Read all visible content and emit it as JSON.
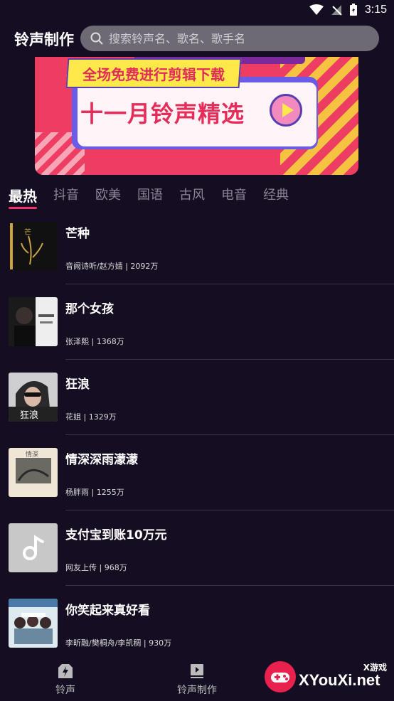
{
  "status": {
    "time": "3:15"
  },
  "header": {
    "title": "铃声制作",
    "search_placeholder": "搜索铃声名、歌名、歌手名"
  },
  "banner": {
    "tag_text": "全场免费进行剪辑下载",
    "headline": "十一月铃声精选"
  },
  "tabs": [
    {
      "label": "最热",
      "active": true
    },
    {
      "label": "抖音",
      "active": false
    },
    {
      "label": "欧美",
      "active": false
    },
    {
      "label": "国语",
      "active": false
    },
    {
      "label": "古风",
      "active": false
    },
    {
      "label": "电音",
      "active": false
    },
    {
      "label": "经典",
      "active": false
    }
  ],
  "songs": [
    {
      "title": "芒种",
      "meta": "音阙诗听/赵方婧 | 2092万"
    },
    {
      "title": "那个女孩",
      "meta": "张泽熙 | 1368万"
    },
    {
      "title": "狂浪",
      "meta": "花姐 | 1329万"
    },
    {
      "title": "情深深雨濛濛",
      "meta": "杨胖雨 | 1255万"
    },
    {
      "title": "支付宝到账10万元",
      "meta": "网友上传 | 968万"
    },
    {
      "title": "你笑起来真好看",
      "meta": "李昕融/樊桐舟/李凯稠 | 930万"
    }
  ],
  "bottom_nav": [
    {
      "label": "铃声",
      "icon": "lightning-icon"
    },
    {
      "label": "铃声制作",
      "icon": "video-icon"
    }
  ],
  "watermark": {
    "brand": "XYouXi.net",
    "brand_cn": "X游戏"
  },
  "colors": {
    "background": "#150d22",
    "accent": "#f0316a",
    "banner": "#ee3d63"
  }
}
